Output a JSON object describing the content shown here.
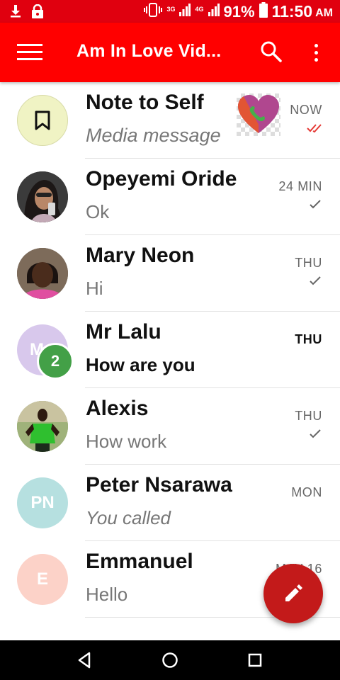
{
  "status_bar": {
    "network_label_top": "3G",
    "network_label_bottom": "4G",
    "battery": "91%",
    "time": "11:50",
    "ampm": "AM"
  },
  "toolbar": {
    "title": "Am In Love Vid..."
  },
  "conversations": [
    {
      "name": "Note to Self",
      "snippet": "Media message",
      "date": "NOW",
      "status": "delivered",
      "avatar_color": "#f0f3c4"
    },
    {
      "name": "Opeyemi Oride",
      "snippet": "Ok",
      "date": "24 MIN",
      "status": "sent"
    },
    {
      "name": "Mary Neon",
      "snippet": "Hi",
      "date": "THU",
      "status": "sent"
    },
    {
      "name": "Mr Lalu",
      "snippet": "How are you",
      "date": "THU",
      "unread_count": "2",
      "avatar_initial": "M",
      "avatar_color": "#d8c8ec"
    },
    {
      "name": "Alexis",
      "snippet": "How work",
      "date": "THU",
      "status": "sent"
    },
    {
      "name": "Peter Nsarawa",
      "snippet": "You called",
      "date": "MON",
      "avatar_initials": "PN",
      "avatar_color": "#b6e0e0"
    },
    {
      "name": "Emmanuel",
      "snippet": "Hello",
      "date": "MAY 16",
      "avatar_initials": "E",
      "avatar_color": "#fcd2c8"
    }
  ],
  "colors": {
    "status_bar": "#e0000f",
    "toolbar": "#ff0000",
    "fab": "#c31a1a",
    "badge": "#43a047",
    "delivered_check": "#e53935"
  }
}
